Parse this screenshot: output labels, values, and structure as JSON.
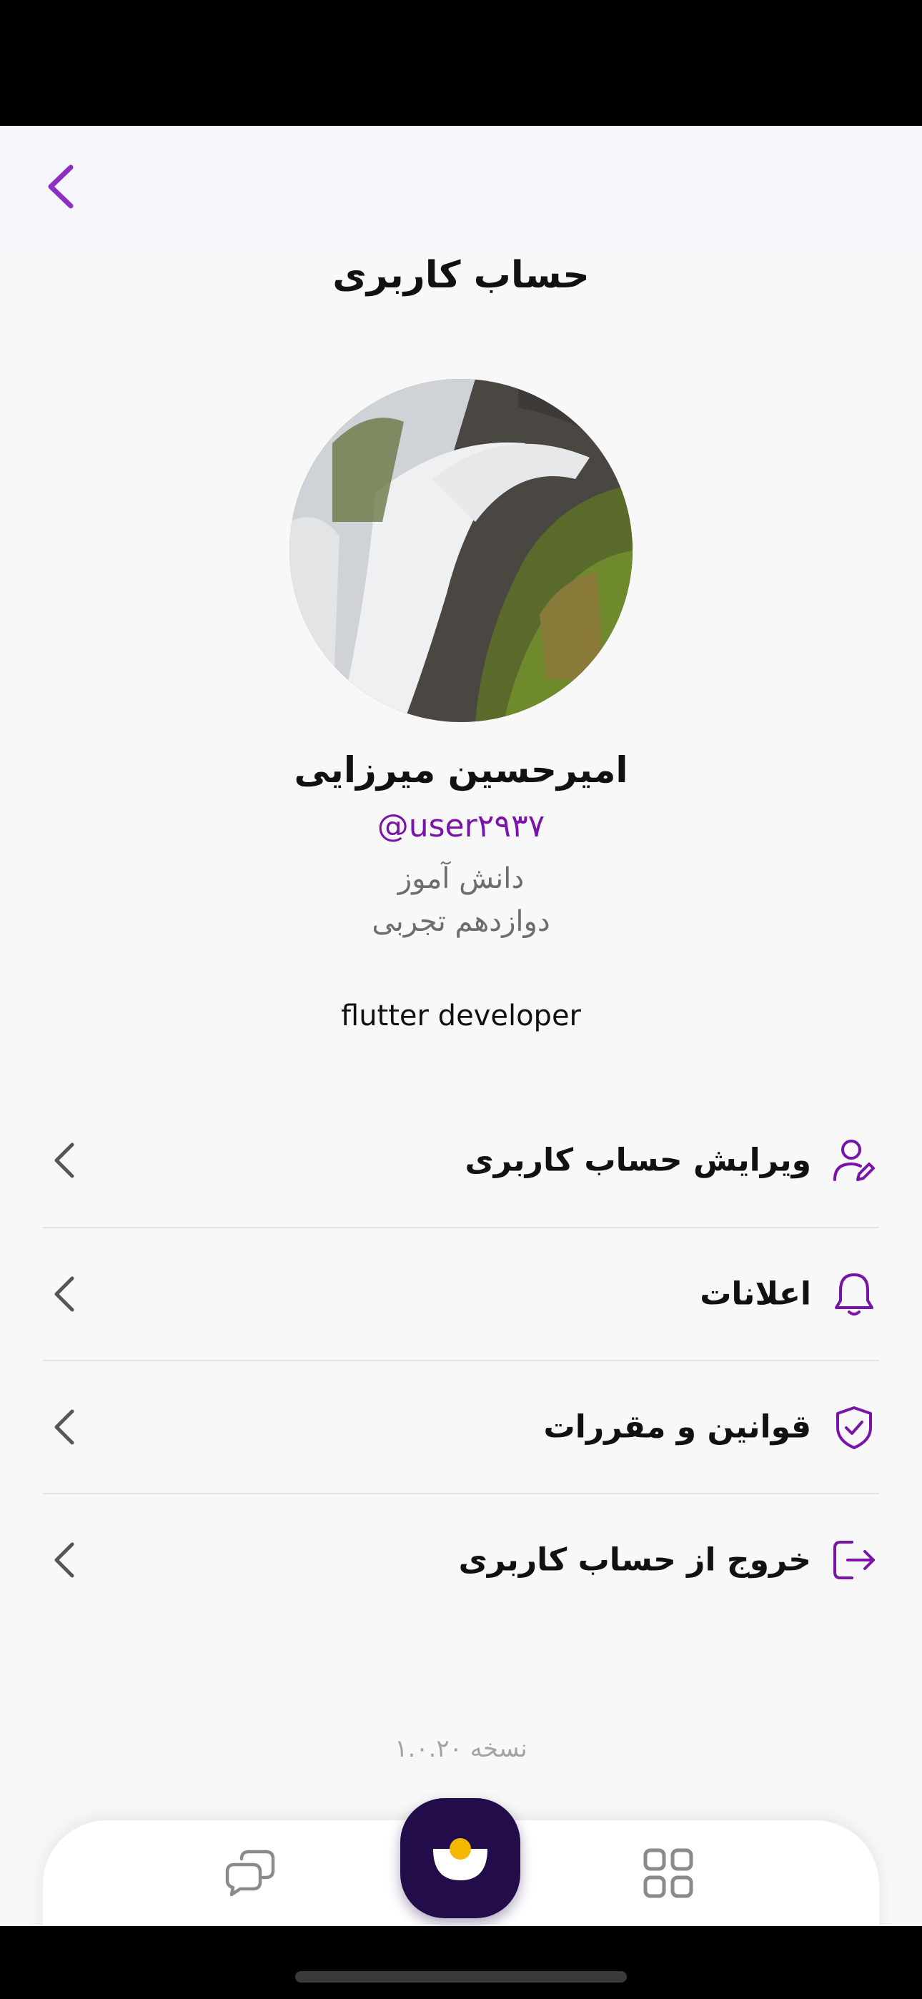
{
  "header": {
    "title": "حساب کاربری"
  },
  "profile": {
    "full_name": "امیرحسین میرزایی",
    "username": "@user۲۹۳۷",
    "role": "دانش آموز",
    "grade": "دوازدهم تجربی",
    "bio": "flutter developer"
  },
  "menu": {
    "items": [
      {
        "label": "ویرایش حساب کاربری",
        "icon": "user-edit-icon"
      },
      {
        "label": "اعلانات",
        "icon": "bell-icon"
      },
      {
        "label": "قوانین و مقررات",
        "icon": "shield-check-icon"
      },
      {
        "label": "خروج از حساب کاربری",
        "icon": "logout-icon"
      }
    ]
  },
  "footer": {
    "version": "نسخه ۱.۰.۲۰"
  },
  "colors": {
    "accent": "#7a14a8",
    "nav_center": "#220c4a",
    "nav_dot": "#f5b800"
  }
}
